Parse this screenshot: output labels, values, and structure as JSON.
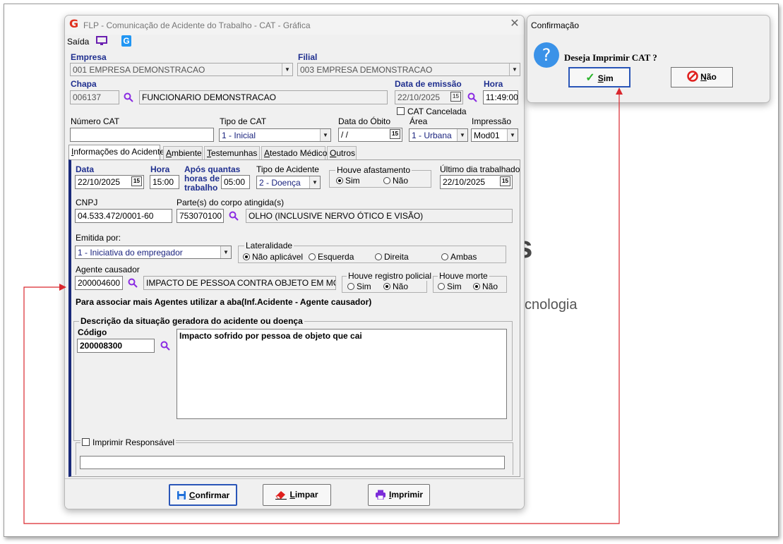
{
  "background": {
    "partial_text_s": "s",
    "partial_text_tecnologia": "cnologia"
  },
  "window": {
    "title": "FLP - Comunicação de Acidente do Trabalho - CAT - Gráfica",
    "menu_saida": "Saída",
    "empresa_label": "Empresa",
    "empresa_value": "001 EMPRESA DEMONSTRACAO",
    "filial_label": "Filial",
    "filial_value": "003 EMPRESA DEMONSTRACAO",
    "chapa_label": "Chapa",
    "chapa_value": "006137",
    "funcionario_value": "FUNCIONARIO DEMONSTRACAO",
    "data_emissao_label": "Data de emissão",
    "data_emissao_value": "22/10/2025",
    "hora_label": "Hora",
    "hora_value": "11:49:00",
    "cat_cancelada_label": "CAT Cancelada",
    "numero_cat_label": "Número CAT",
    "numero_cat_value": "",
    "tipo_cat_label": "Tipo de CAT",
    "tipo_cat_value": "1  - Inicial",
    "data_obito_label": "Data do Óbito",
    "data_obito_value": " / /",
    "area_label": "Área",
    "area_value": "1 - Urbana",
    "impressao_label": "Impressão",
    "impressao_value": "Mod01"
  },
  "tabs": [
    {
      "label": "Informações do Acidente",
      "underline": "I",
      "rest": "nformações do Acidente"
    },
    {
      "label": "Ambiente",
      "underline": "A",
      "rest": "mbiente"
    },
    {
      "label": "Testemunhas",
      "underline": "T",
      "rest": "estemunhas"
    },
    {
      "label": "Atestado Médico",
      "underline": "A",
      "rest": "testado Médico"
    },
    {
      "label": "Outros",
      "underline": "O",
      "rest": "utros"
    }
  ],
  "panel": {
    "data_label": "Data",
    "data_value": "22/10/2025",
    "hora_label": "Hora",
    "hora_value": "15:00",
    "apos_label_1": "Após quantas",
    "apos_label_2": "horas de",
    "apos_label_3": "trabalho",
    "apos_value": "05:00",
    "tipo_acidente_label": "Tipo de Acidente",
    "tipo_acidente_value": "2 - Doença",
    "afastamento_label": "Houve afastamento",
    "afastamento_sim": "Sim",
    "afastamento_nao": "Não",
    "ultimo_dia_label": "Último dia trabalhado",
    "ultimo_dia_value": "22/10/2025",
    "cnpj_label": "CNPJ",
    "cnpj_value": "04.533.472/0001-60",
    "partes_label": "Parte(s) do corpo atingida(s)",
    "partes_code": "753070100",
    "partes_desc": "OLHO (INCLUSIVE NERVO ÓTICO E VISÃO)",
    "emitida_label": "Emitida por:",
    "emitida_value": "1 - Iniciativa do empregador",
    "lateralidade_label": "Lateralidade",
    "lat_na": "Não aplicável",
    "lat_esq": "Esquerda",
    "lat_dir": "Direita",
    "lat_amb": "Ambas",
    "agente_label": "Agente causador",
    "agente_code": "200004600",
    "agente_desc": "IMPACTO DE PESSOA CONTRA OBJETO EM MOVIM",
    "policial_label": "Houve registro policial",
    "policial_sim": "Sim",
    "policial_nao": "Não",
    "morte_label": "Houve morte",
    "morte_sim": "Sim",
    "morte_nao": "Não",
    "info_text": "Para associar mais Agentes utilizar a aba(Inf.Acidente - Agente causador)",
    "descricao_label": "Descrição da situação geradora do acidente ou doença",
    "codigo_label": "Código",
    "codigo_value": "200008300",
    "descricao_text": "Impacto sofrido por pessoa de objeto que cai",
    "imprimir_resp_label": "Imprimir Responsável",
    "imprimir_resp_value": ""
  },
  "footer": {
    "confirmar": "Confirmar",
    "confirmar_u": "C",
    "confirmar_rest": "onfirmar",
    "limpar_u": "L",
    "limpar_rest": "impar",
    "imprimir_u": "I",
    "imprimir_rest": "mprimir"
  },
  "dialog": {
    "title": "Confirmação",
    "message": "Deseja Imprimir CAT ?",
    "sim_u": "S",
    "sim_rest": "im",
    "nao_u": "N",
    "nao_rest": "ão"
  },
  "colors": {
    "label_blue": "#1f2f8f",
    "accent_blue": "#2a56b8",
    "arrow_red": "#d9272e",
    "magnifier": "#8a2be2"
  }
}
